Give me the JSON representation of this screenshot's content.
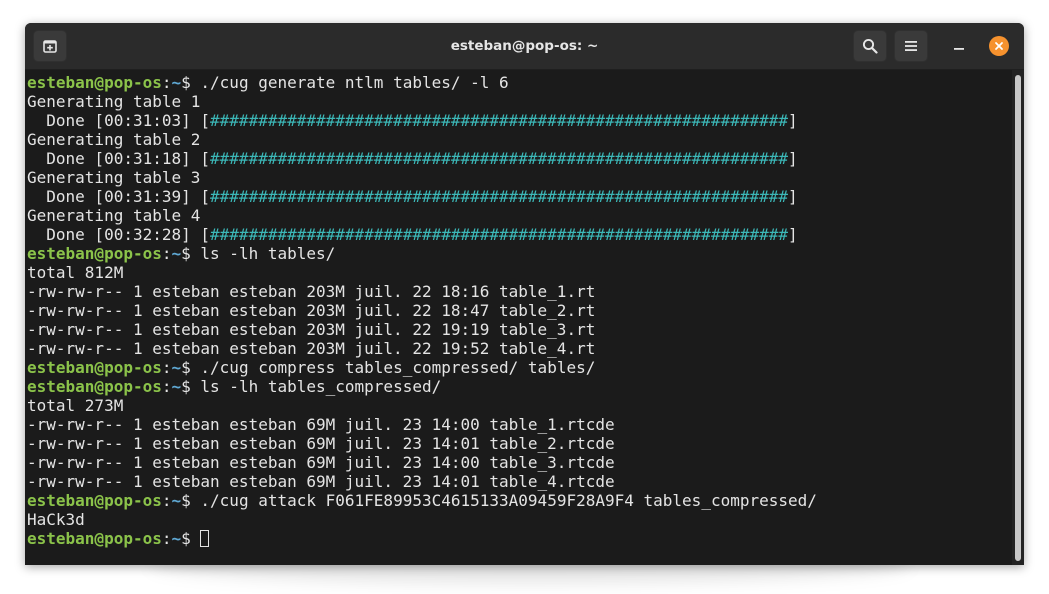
{
  "window": {
    "title": "esteban@pop-os: ~",
    "colors": {
      "prompt_user": "#8bc34a",
      "prompt_path": "#5fa8d3",
      "progress_bar": "#3cb8b8",
      "close_button": "#f6922e",
      "terminal_bg": "#1b1b1b"
    },
    "icons": {
      "new_tab": "new-tab-icon",
      "search": "search-icon",
      "menu": "hamburger-menu-icon",
      "minimize": "minimize-icon",
      "close": "close-icon"
    }
  },
  "prompt": {
    "user_host": "esteban@pop-os",
    "sep": ":",
    "path": "~",
    "symbol": "$ "
  },
  "terminal": {
    "lines": [
      {
        "type": "cmd",
        "text": "./cug generate ntlm tables/ -l 6"
      },
      {
        "type": "out",
        "text": "Generating table 1"
      },
      {
        "type": "progress",
        "prefix": "  Done [00:31:03] [",
        "bar": "############################################################",
        "suffix": "]"
      },
      {
        "type": "out",
        "text": "Generating table 2"
      },
      {
        "type": "progress",
        "prefix": "  Done [00:31:18] [",
        "bar": "############################################################",
        "suffix": "]"
      },
      {
        "type": "out",
        "text": "Generating table 3"
      },
      {
        "type": "progress",
        "prefix": "  Done [00:31:39] [",
        "bar": "############################################################",
        "suffix": "]"
      },
      {
        "type": "out",
        "text": "Generating table 4"
      },
      {
        "type": "progress",
        "prefix": "  Done [00:32:28] [",
        "bar": "############################################################",
        "suffix": "]"
      },
      {
        "type": "cmd",
        "text": "ls -lh tables/"
      },
      {
        "type": "out",
        "text": "total 812M"
      },
      {
        "type": "out",
        "text": "-rw-rw-r-- 1 esteban esteban 203M juil. 22 18:16 table_1.rt"
      },
      {
        "type": "out",
        "text": "-rw-rw-r-- 1 esteban esteban 203M juil. 22 18:47 table_2.rt"
      },
      {
        "type": "out",
        "text": "-rw-rw-r-- 1 esteban esteban 203M juil. 22 19:19 table_3.rt"
      },
      {
        "type": "out",
        "text": "-rw-rw-r-- 1 esteban esteban 203M juil. 22 19:52 table_4.rt"
      },
      {
        "type": "cmd",
        "text": "./cug compress tables_compressed/ tables/"
      },
      {
        "type": "cmd",
        "text": "ls -lh tables_compressed/"
      },
      {
        "type": "out",
        "text": "total 273M"
      },
      {
        "type": "out",
        "text": "-rw-rw-r-- 1 esteban esteban 69M juil. 23 14:00 table_1.rtcde"
      },
      {
        "type": "out",
        "text": "-rw-rw-r-- 1 esteban esteban 69M juil. 23 14:01 table_2.rtcde"
      },
      {
        "type": "out",
        "text": "-rw-rw-r-- 1 esteban esteban 69M juil. 23 14:00 table_3.rtcde"
      },
      {
        "type": "out",
        "text": "-rw-rw-r-- 1 esteban esteban 69M juil. 23 14:01 table_4.rtcde"
      },
      {
        "type": "cmd",
        "text": "./cug attack F061FE89953C4615133A09459F28A9F4 tables_compressed/"
      },
      {
        "type": "out",
        "text": "HaCk3d"
      },
      {
        "type": "cmd",
        "text": "",
        "cursor": true
      }
    ]
  }
}
